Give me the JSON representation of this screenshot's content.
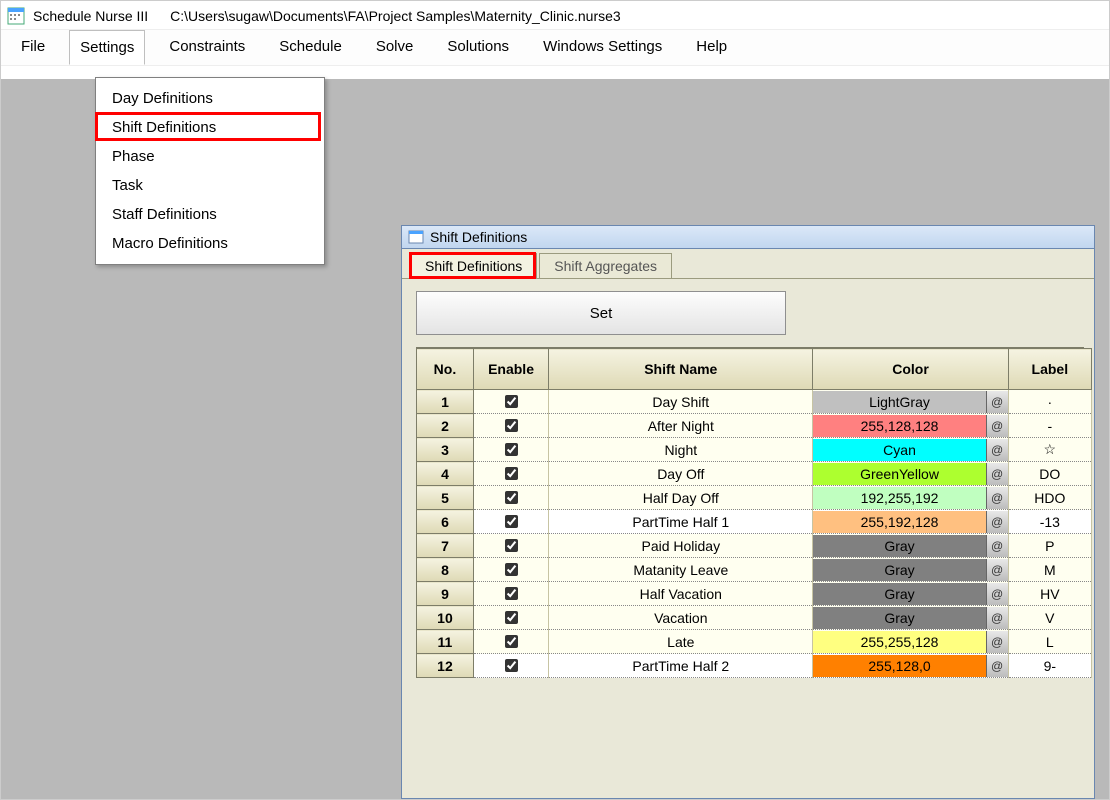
{
  "titlebar": {
    "app": "Schedule Nurse III",
    "path": "C:\\Users\\sugaw\\Documents\\FA\\Project Samples\\Maternity_Clinic.nurse3"
  },
  "menubar": [
    "File",
    "Settings",
    "Constraints",
    "Schedule",
    "Solve",
    "Solutions",
    "Windows Settings",
    "Help"
  ],
  "menubar_active": "Settings",
  "dropdown": [
    "Day Definitions",
    "Shift Definitions",
    "Phase",
    "Task",
    "Staff Definitions",
    "Macro Definitions"
  ],
  "dropdown_highlight": "Shift Definitions",
  "panel": {
    "title": "Shift Definitions",
    "tabs": [
      "Shift Definitions",
      "Shift Aggregates"
    ],
    "active_tab": "Shift Definitions",
    "set_button": "Set",
    "columns": [
      "No.",
      "Enable",
      "Shift Name",
      "Color",
      "Label"
    ],
    "rows": [
      {
        "no": "1",
        "enable": true,
        "name": "Day Shift",
        "color_label": "LightGray",
        "color_hex": "#c0c0c0",
        "label": "·"
      },
      {
        "no": "2",
        "enable": true,
        "name": "After Night",
        "color_label": "255,128,128",
        "color_hex": "#ff8080",
        "label": "-"
      },
      {
        "no": "3",
        "enable": true,
        "name": "Night",
        "color_label": "Cyan",
        "color_hex": "#00ffff",
        "label": "☆"
      },
      {
        "no": "4",
        "enable": true,
        "name": "Day Off",
        "color_label": "GreenYellow",
        "color_hex": "#adff2f",
        "label": "DO"
      },
      {
        "no": "5",
        "enable": true,
        "name": "Half Day Off",
        "color_label": "192,255,192",
        "color_hex": "#c0ffc0",
        "label": "HDO"
      },
      {
        "no": "6",
        "enable": true,
        "name": "PartTime Half 1",
        "color_label": "255,192,128",
        "color_hex": "#ffc080",
        "label": "-13"
      },
      {
        "no": "7",
        "enable": true,
        "name": "Paid Holiday",
        "color_label": "Gray",
        "color_hex": "#808080",
        "label": "P"
      },
      {
        "no": "8",
        "enable": true,
        "name": "Matanity Leave",
        "color_label": "Gray",
        "color_hex": "#808080",
        "label": "M"
      },
      {
        "no": "9",
        "enable": true,
        "name": "Half Vacation",
        "color_label": "Gray",
        "color_hex": "#808080",
        "label": "HV"
      },
      {
        "no": "10",
        "enable": true,
        "name": "Vacation",
        "color_label": "Gray",
        "color_hex": "#808080",
        "label": "V"
      },
      {
        "no": "11",
        "enable": true,
        "name": "Late",
        "color_label": "255,255,128",
        "color_hex": "#ffff80",
        "label": "L"
      },
      {
        "no": "12",
        "enable": true,
        "name": "PartTime Half 2",
        "color_label": "255,128,0",
        "color_hex": "#ff8000",
        "label": "9-"
      }
    ]
  }
}
